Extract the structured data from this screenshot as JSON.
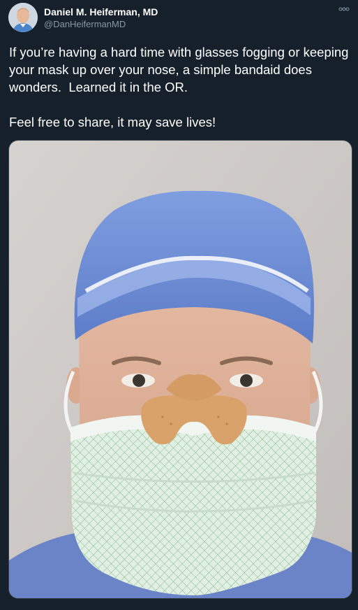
{
  "author": {
    "display_name": "Daniel M. Heiferman, MD",
    "handle": "@DanHeifermanMD"
  },
  "tweet": {
    "text": "If you’re having a hard time with glasses fogging or keeping your mask up over your nose, a simple bandaid does wonders.  Learned it in the OR.\n\nFeel free to share, it may save lives!"
  },
  "icons": {
    "more": "more-options-icon",
    "avatar": "avatar-photo"
  },
  "colors": {
    "background": "#15202b",
    "secondary_text": "#8899a6",
    "border": "#38444d",
    "scrub_cap": "#6f8fd6",
    "mask": "#dfeee2",
    "bandaid": "#d9a26a"
  }
}
